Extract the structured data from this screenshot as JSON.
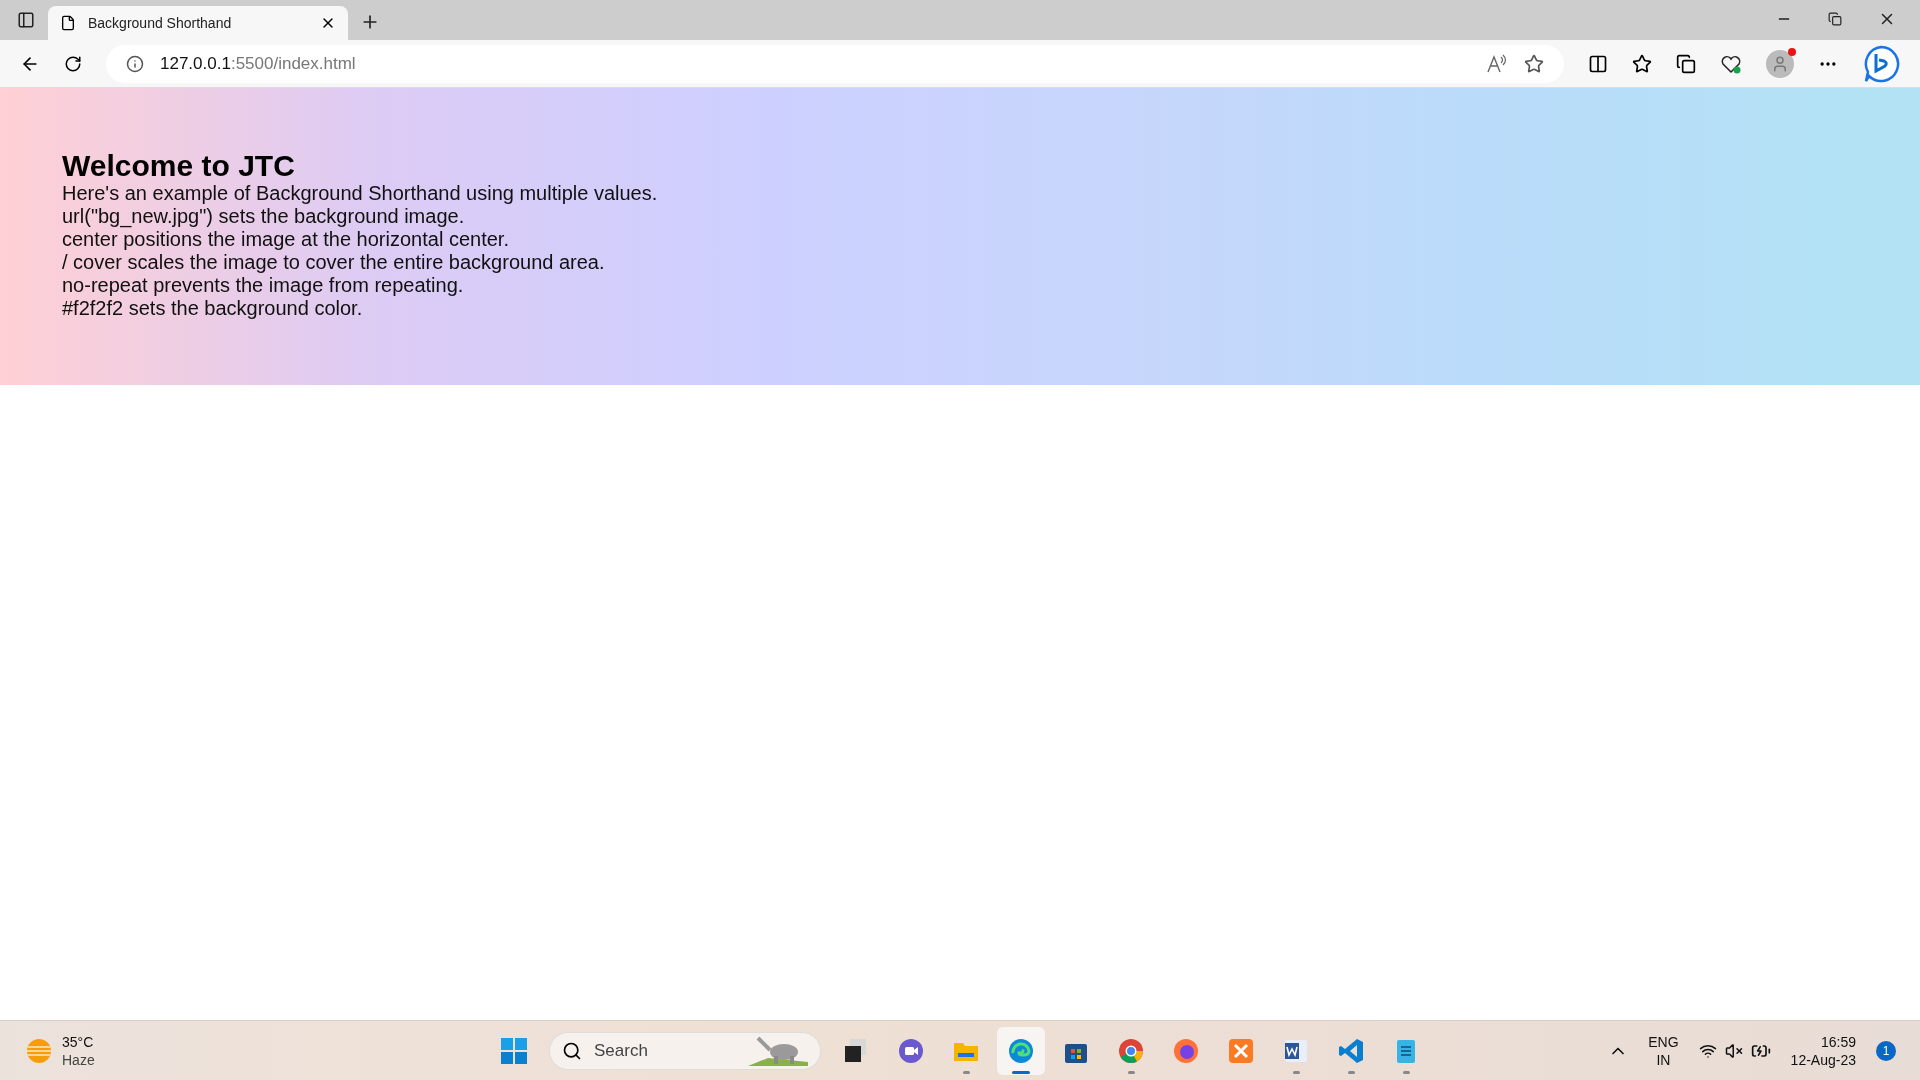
{
  "browser": {
    "tabs": [
      {
        "title": "Background Shorthand",
        "selected": true
      }
    ],
    "address": {
      "host": "127.0.0.1",
      "rest": ":5500/index.html"
    }
  },
  "page": {
    "heading": "Welcome to JTC",
    "lines": [
      "Here's an example of Background Shorthand using multiple values.",
      "url(\"bg_new.jpg\") sets the background image.",
      "center positions the image at the horizontal center.",
      "/ cover scales the image to cover the entire background area.",
      "no-repeat prevents the image from repeating.",
      "#f2f2f2 sets the background color."
    ]
  },
  "taskbar": {
    "weather": {
      "temperature": "35°C",
      "condition": "Haze"
    },
    "search": {
      "placeholder": "Search"
    },
    "apps": [
      {
        "kind": "start",
        "running": false,
        "selected": false
      },
      {
        "kind": "taskview",
        "running": false,
        "selected": false
      },
      {
        "kind": "chat",
        "running": false,
        "selected": false
      },
      {
        "kind": "folder",
        "running": true,
        "selected": false
      },
      {
        "kind": "edge",
        "running": true,
        "selected": true
      },
      {
        "kind": "store",
        "running": false,
        "selected": false
      },
      {
        "kind": "chrome",
        "running": true,
        "selected": false
      },
      {
        "kind": "firefox",
        "running": false,
        "selected": false
      },
      {
        "kind": "xampp",
        "running": false,
        "selected": false
      },
      {
        "kind": "word",
        "running": true,
        "selected": false
      },
      {
        "kind": "vscode",
        "running": true,
        "selected": false
      },
      {
        "kind": "notepad",
        "running": true,
        "selected": false
      }
    ],
    "language": {
      "code": "ENG",
      "region": "IN"
    },
    "time": "16:59",
    "date": "12-Aug-23",
    "notifications": "1"
  }
}
